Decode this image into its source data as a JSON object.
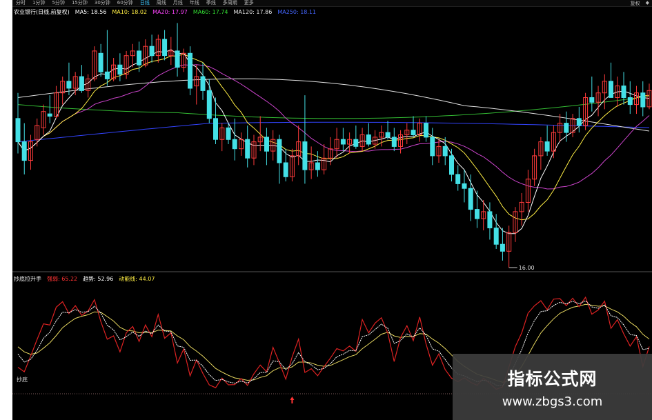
{
  "toolbar": {
    "tabs": [
      "分时",
      "1分钟",
      "5分钟",
      "15分钟",
      "30分钟",
      "60分钟",
      "日线",
      "周线",
      "月线",
      "年线",
      "季线",
      "多周期",
      "更多"
    ],
    "active_tab": "日线",
    "right_items": [
      "复权",
      "◆"
    ]
  },
  "main_legend": {
    "title": "农业银行(日线,前复权)",
    "ma": [
      {
        "label": "MA5: 18.56",
        "color": "#ffffff"
      },
      {
        "label": "MA10: 18.02",
        "color": "#ffee44"
      },
      {
        "label": "MA20: 17.97",
        "color": "#ff44ff"
      },
      {
        "label": "MA60: 17.74",
        "color": "#33dd33"
      },
      {
        "label": "MA120: 17.86",
        "color": "#e8e8e8"
      },
      {
        "label": "MA250: 18.11",
        "color": "#4466ff"
      }
    ]
  },
  "sub_legend": {
    "title": "抄底拉升手",
    "items": [
      {
        "label": "强弱: 65.22",
        "color": "#ff3333"
      },
      {
        "label": "趋势: 52.96",
        "color": "#ffffff"
      },
      {
        "label": "动能线: 44.07",
        "color": "#ffee44"
      }
    ]
  },
  "low_marker": "16.00",
  "sub_label": "抄底",
  "watermark": {
    "title": "指标公式网",
    "url": "www.zbgs3.com"
  },
  "colors": {
    "up": "#ff3b3b",
    "down": "#44e0e6",
    "ma5": "#ffffff",
    "ma10": "#ffee44",
    "ma20": "#cc44cc",
    "ma60": "#33bb33",
    "ma120": "#e0e0e0",
    "ma250": "#3344ff",
    "k_line": "#dd2222",
    "d_line": "#ffffff",
    "j_line": "#e8d860"
  },
  "chart_data": {
    "type": "candlestick",
    "ohlc": [
      [
        17.4,
        17.95,
        16.65,
        16.9
      ],
      [
        16.9,
        17.3,
        16.2,
        16.5
      ],
      [
        16.5,
        17.05,
        16.3,
        16.9
      ],
      [
        16.95,
        17.4,
        16.8,
        17.25
      ],
      [
        17.2,
        17.7,
        17.05,
        17.55
      ],
      [
        17.5,
        17.9,
        17.3,
        17.45
      ],
      [
        17.45,
        18.1,
        17.4,
        17.95
      ],
      [
        17.95,
        18.3,
        17.7,
        18.2
      ],
      [
        18.2,
        18.6,
        17.9,
        18.05
      ],
      [
        18.05,
        18.4,
        17.9,
        18.3
      ],
      [
        18.3,
        18.55,
        17.95,
        18.0
      ],
      [
        18.0,
        18.35,
        17.85,
        18.25
      ],
      [
        18.25,
        18.95,
        18.2,
        18.85
      ],
      [
        18.8,
        19.0,
        18.3,
        18.4
      ],
      [
        18.4,
        19.3,
        18.1,
        18.25
      ],
      [
        18.25,
        18.7,
        18.2,
        18.55
      ],
      [
        18.55,
        18.8,
        18.2,
        18.35
      ],
      [
        18.35,
        18.85,
        18.25,
        18.75
      ],
      [
        18.75,
        19.0,
        18.5,
        18.85
      ],
      [
        18.85,
        19.05,
        18.4,
        18.55
      ],
      [
        18.55,
        19.1,
        18.5,
        18.95
      ],
      [
        18.95,
        19.2,
        18.6,
        18.75
      ],
      [
        18.75,
        19.2,
        18.6,
        19.1
      ],
      [
        19.1,
        19.3,
        18.65,
        18.75
      ],
      [
        18.75,
        19.15,
        18.55,
        18.85
      ],
      [
        18.85,
        19.45,
        18.3,
        18.5
      ],
      [
        18.5,
        18.9,
        18.4,
        18.8
      ],
      [
        18.8,
        18.95,
        17.9,
        18.05
      ],
      [
        18.1,
        18.55,
        17.7,
        18.3
      ],
      [
        18.3,
        18.6,
        17.8,
        18.0
      ],
      [
        18.0,
        18.25,
        17.3,
        17.4
      ],
      [
        17.4,
        17.85,
        16.85,
        16.95
      ],
      [
        16.95,
        17.3,
        16.7,
        17.2
      ],
      [
        17.2,
        17.3,
        16.85,
        16.95
      ],
      [
        16.95,
        17.4,
        16.5,
        16.75
      ],
      [
        16.75,
        17.1,
        16.6,
        16.95
      ],
      [
        16.95,
        17.25,
        16.35,
        16.55
      ],
      [
        16.55,
        17.05,
        16.4,
        16.9
      ],
      [
        16.9,
        17.45,
        16.7,
        17.0
      ],
      [
        17.0,
        17.2,
        16.4,
        16.7
      ],
      [
        16.7,
        17.15,
        16.5,
        16.95
      ],
      [
        16.95,
        17.05,
        16.0,
        16.45
      ],
      [
        16.45,
        16.75,
        16.05,
        16.15
      ],
      [
        16.15,
        16.75,
        16.05,
        16.6
      ],
      [
        16.6,
        17.25,
        16.4,
        16.9
      ],
      [
        16.9,
        17.9,
        16.0,
        16.3
      ],
      [
        16.3,
        16.8,
        16.1,
        16.45
      ],
      [
        16.45,
        16.7,
        16.15,
        16.3
      ],
      [
        16.3,
        16.85,
        16.2,
        16.55
      ],
      [
        16.55,
        17.0,
        16.4,
        16.75
      ],
      [
        16.75,
        17.2,
        16.55,
        16.95
      ],
      [
        16.95,
        17.2,
        16.7,
        16.85
      ],
      [
        16.85,
        17.1,
        16.65,
        16.95
      ],
      [
        16.95,
        17.25,
        16.75,
        16.8
      ],
      [
        16.8,
        17.2,
        16.7,
        17.05
      ],
      [
        17.05,
        17.3,
        16.8,
        16.85
      ],
      [
        16.85,
        17.15,
        16.75,
        17.0
      ],
      [
        17.0,
        17.25,
        16.8,
        17.1
      ],
      [
        17.1,
        17.35,
        16.95,
        17.0
      ],
      [
        17.0,
        17.2,
        16.7,
        16.8
      ],
      [
        16.8,
        17.15,
        16.65,
        17.05
      ],
      [
        17.05,
        17.3,
        16.85,
        17.15
      ],
      [
        17.15,
        17.45,
        17.0,
        17.05
      ],
      [
        17.05,
        17.4,
        16.9,
        17.3
      ],
      [
        17.3,
        17.45,
        16.9,
        17.0
      ],
      [
        17.0,
        17.2,
        16.4,
        16.6
      ],
      [
        16.6,
        16.95,
        16.45,
        16.8
      ],
      [
        16.8,
        17.0,
        16.4,
        16.6
      ],
      [
        16.6,
        16.75,
        16.05,
        16.2
      ],
      [
        16.2,
        16.4,
        15.85,
        16.0
      ],
      [
        16.0,
        16.3,
        15.6,
        15.9
      ],
      [
        15.9,
        16.2,
        15.2,
        15.45
      ],
      [
        15.45,
        15.85,
        15.05,
        15.25
      ],
      [
        15.25,
        15.65,
        15.0,
        15.4
      ],
      [
        15.4,
        15.6,
        14.8,
        15.05
      ],
      [
        15.05,
        15.35,
        14.6,
        14.7
      ],
      [
        14.7,
        15.05,
        14.35,
        14.55
      ],
      [
        14.55,
        15.1,
        14.2,
        14.95
      ],
      [
        14.95,
        15.5,
        14.75,
        15.4
      ],
      [
        15.4,
        15.8,
        15.1,
        15.6
      ],
      [
        15.6,
        16.3,
        15.4,
        16.1
      ],
      [
        16.1,
        16.75,
        15.95,
        16.6
      ],
      [
        16.6,
        17.0,
        16.3,
        16.9
      ],
      [
        16.9,
        17.25,
        16.6,
        16.7
      ],
      [
        16.7,
        17.25,
        16.55,
        17.1
      ],
      [
        17.1,
        17.5,
        16.9,
        17.3
      ],
      [
        17.3,
        17.55,
        16.9,
        17.1
      ],
      [
        17.1,
        17.5,
        17.0,
        17.4
      ],
      [
        17.4,
        17.65,
        17.1,
        17.25
      ],
      [
        17.25,
        17.95,
        17.15,
        17.85
      ],
      [
        17.85,
        18.3,
        17.55,
        17.75
      ],
      [
        17.75,
        18.1,
        17.45,
        17.95
      ],
      [
        17.95,
        18.35,
        17.6,
        18.2
      ],
      [
        18.2,
        18.6,
        17.9,
        17.85
      ],
      [
        17.85,
        18.3,
        17.65,
        18.1
      ],
      [
        18.1,
        18.4,
        17.7,
        17.85
      ],
      [
        17.85,
        18.2,
        17.5,
        17.7
      ],
      [
        17.7,
        18.1,
        17.5,
        17.95
      ],
      [
        17.95,
        18.2,
        17.45,
        17.65
      ],
      [
        17.65,
        18.15,
        17.6,
        18.0
      ]
    ],
    "ylim": [
      14.2,
      19.5
    ],
    "sub_ylim": [
      0,
      100
    ]
  }
}
